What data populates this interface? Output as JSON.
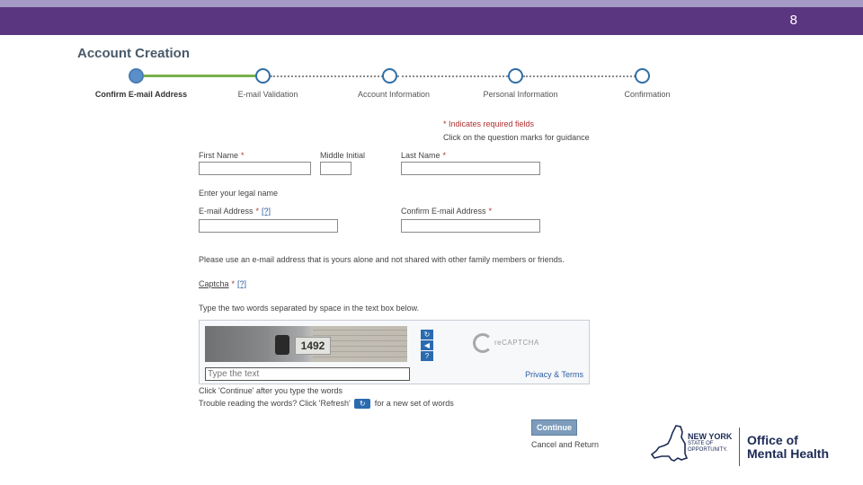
{
  "header": {
    "slide_number": "8"
  },
  "page": {
    "title": "Account Creation"
  },
  "steps": [
    {
      "label": "Confirm E-mail Address",
      "active": true
    },
    {
      "label": "E-mail Validation",
      "active": false
    },
    {
      "label": "Account Information",
      "active": false
    },
    {
      "label": "Personal Information",
      "active": false
    },
    {
      "label": "Confirmation",
      "active": false
    }
  ],
  "notes": {
    "required": "* Indicates required fields",
    "guidance": "Click on the question marks for guidance"
  },
  "form": {
    "first_name_label": "First Name",
    "middle_initial_label": "Middle Initial",
    "last_name_label": "Last Name",
    "legal_name_hint": "Enter your legal name",
    "email_label": "E-mail Address",
    "confirm_email_label": "Confirm E-mail Address",
    "email_notice": "Please use an e-mail address that is yours alone and not shared with other family members or friends.",
    "captcha_label": "Captcha",
    "help_marker": "[?]",
    "required_marker": "*",
    "captcha_instruction": "Type the two words separated by space in the text box below.",
    "continue_hint": "Click 'Continue' after you type the words",
    "trouble_text": "Trouble reading the words? Click 'Refresh'",
    "trouble_suffix": "for a new set of words"
  },
  "captcha": {
    "image_text": "1492",
    "input_placeholder": "Type the text",
    "privacy_link": "Privacy & Terms",
    "logo_text": "reCAPTCHA",
    "refresh_glyph": "↻",
    "audio_glyph": "◀",
    "help_glyph": "?"
  },
  "actions": {
    "continue_label": "Continue",
    "cancel_label": "Cancel and Return"
  },
  "branding": {
    "state_line1": "NEW YORK",
    "state_line2": "STATE OF",
    "state_line3": "OPPORTUNITY.",
    "office_line1": "Office of",
    "office_line2": "Mental Health"
  },
  "colors": {
    "header_bar": "#5b3680",
    "header_strip": "#a59ac6",
    "progress_done": "#78b04b",
    "required_red": "#b03030",
    "link_blue": "#2a5fa0",
    "continue_button": "#7d9cbc",
    "brand_navy": "#1c2a55"
  }
}
